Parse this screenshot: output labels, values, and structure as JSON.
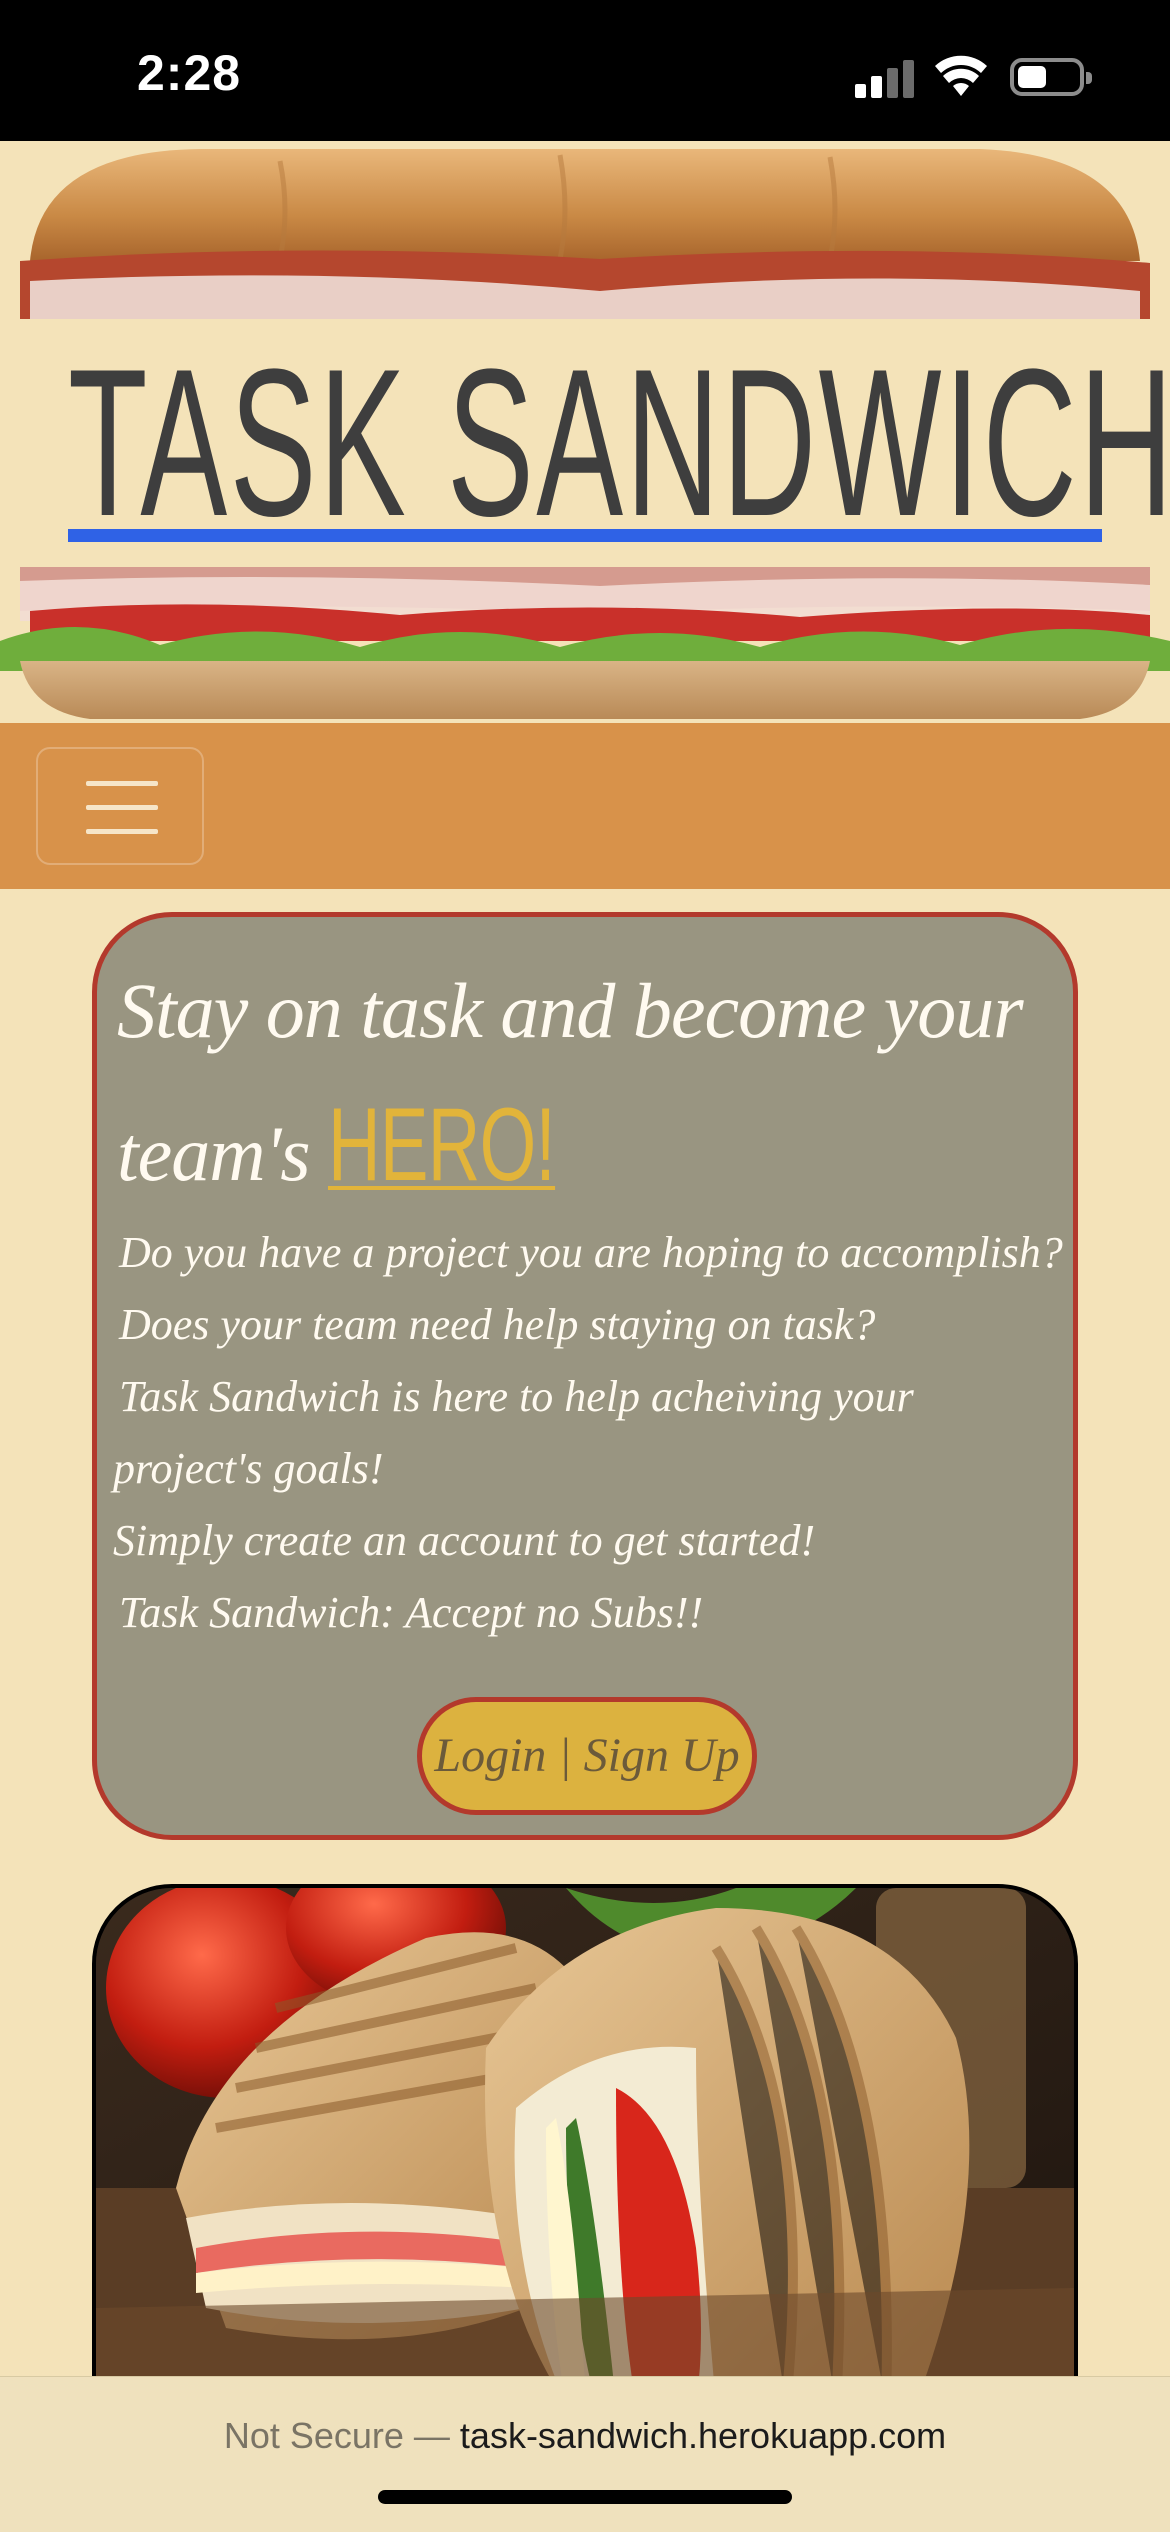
{
  "status_bar": {
    "time": "2:28",
    "icons": [
      "signal-icon",
      "wifi-icon",
      "battery-icon"
    ]
  },
  "header": {
    "site_title": "TASK SANDWICH",
    "underline_color": "#2f62e6"
  },
  "navbar": {
    "menu_icon": "hamburger-menu-icon",
    "color": "#d8924a"
  },
  "hero": {
    "heading_line1": "Stay on task and become your",
    "heading_line2_prefix": "team's ",
    "heading_highlight": "HERO!",
    "body_lines": [
      "Do you have a project you are hoping to accomplish?",
      "Does your team need help staying on task?",
      "Task Sandwich is here to help acheiving your",
      "project's goals!",
      "Simply create an account to get started!",
      "Task Sandwich: Accept no Subs!!"
    ],
    "login_button": "Login | Sign Up",
    "card_color": "#999581",
    "border_color": "#b3392c",
    "highlight_color": "#e2b43a"
  },
  "photo": {
    "description_icon": "sandwich-photo"
  },
  "browser": {
    "security_label": "Not Secure — ",
    "domain": "task-sandwich.herokuapp.com"
  }
}
